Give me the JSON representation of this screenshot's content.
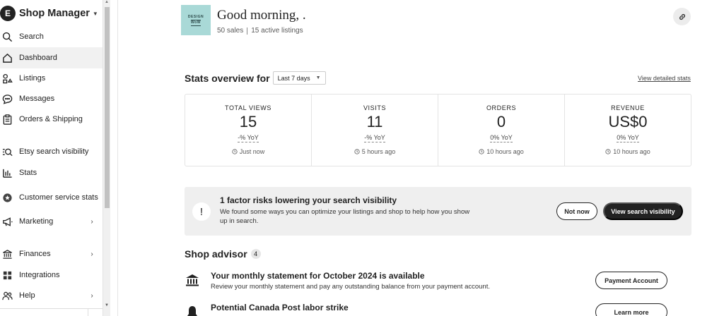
{
  "sidebar": {
    "brand_initial": "E",
    "brand_title": "Shop Manager",
    "items": [
      {
        "label": "Search",
        "icon": "search-icon"
      },
      {
        "label": "Dashboard",
        "icon": "home-icon",
        "active": true
      },
      {
        "label": "Listings",
        "icon": "listings-icon"
      },
      {
        "label": "Messages",
        "icon": "messages-icon"
      },
      {
        "label": "Orders & Shipping",
        "icon": "clipboard-icon"
      },
      {
        "label": "Etsy search visibility",
        "icon": "search-visibility-icon"
      },
      {
        "label": "Stats",
        "icon": "bar-chart-icon"
      },
      {
        "label": "Customer service stats",
        "icon": "star-badge-icon"
      },
      {
        "label": "Marketing",
        "icon": "megaphone-icon",
        "chevron": true
      },
      {
        "label": "Finances",
        "icon": "bank-icon",
        "chevron": true
      },
      {
        "label": "Integrations",
        "icon": "grid-icon"
      },
      {
        "label": "Help",
        "icon": "people-icon",
        "chevron": true
      }
    ]
  },
  "header": {
    "shop_logo_line1": "DESIGN",
    "shop_logo_line2": "WoW",
    "greeting": "Good morning, .",
    "sales": "50 sales",
    "active_listings": "15 active listings",
    "link_icon": "link-icon"
  },
  "stats": {
    "title": "Stats overview for",
    "range": "Last 7 days",
    "view_detailed": "View detailed stats",
    "items": [
      {
        "label": "TOTAL VIEWS",
        "value": "15",
        "yoy": "-% YoY",
        "time": "Just now"
      },
      {
        "label": "VISITS",
        "value": "11",
        "yoy": "-% YoY",
        "time": "5 hours ago"
      },
      {
        "label": "ORDERS",
        "value": "0",
        "yoy": "0% YoY",
        "time": "10 hours ago"
      },
      {
        "label": "REVENUE",
        "value": "US$0",
        "yoy": "0% YoY",
        "time": "10 hours ago"
      }
    ]
  },
  "banner": {
    "icon": "!",
    "title": "1 factor risks lowering your search visibility",
    "text": "We found some ways you can optimize your listings and shop to help how you show up in search.",
    "not_now": "Not now",
    "view_visibility": "View search visibility"
  },
  "advisor": {
    "title": "Shop advisor",
    "count": "4",
    "items": [
      {
        "icon": "bank-icon",
        "title": "Your monthly statement for October 2024 is available",
        "text": "Review your monthly statement and pay any outstanding balance from your payment account.",
        "button": "Payment Account"
      },
      {
        "icon": "bell-icon",
        "title": "Potential Canada Post labor strike",
        "text": "",
        "button": "Learn more"
      }
    ]
  },
  "colors": {
    "accent_dark": "#222222",
    "active_bg": "#f1f1f1",
    "banner_bg": "#efefef",
    "shop_logo_bg": "#a9d9d7"
  }
}
